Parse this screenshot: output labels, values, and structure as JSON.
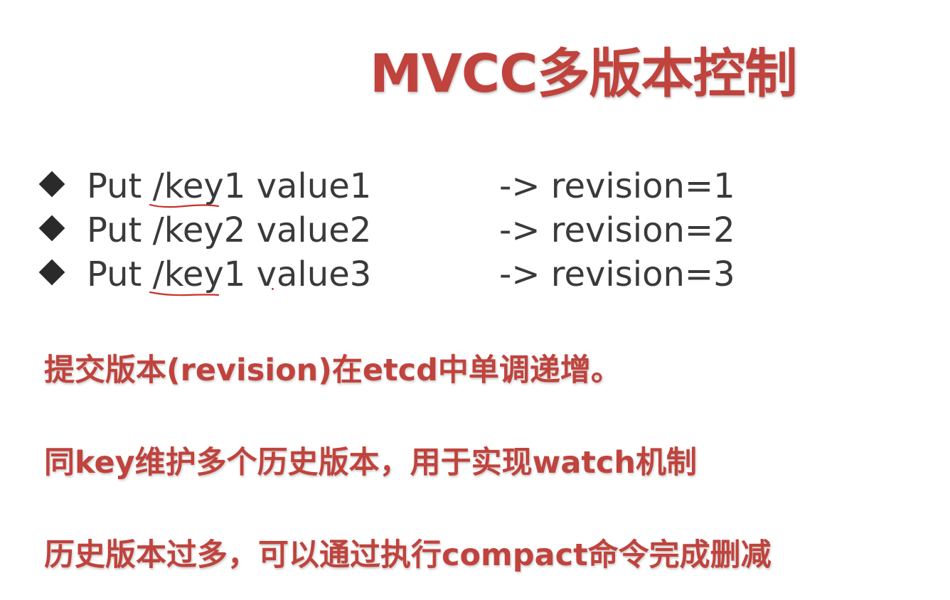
{
  "title": "MVCC多版本控制",
  "commands": [
    {
      "verb": "Put",
      "key": "/key1",
      "value": "value1",
      "revision": "-> revision=1",
      "annotated": true
    },
    {
      "verb": "Put",
      "key": "/key2",
      "value": "value2",
      "revision": "-> revision=2",
      "annotated": false
    },
    {
      "verb": "Put",
      "key": "/key1",
      "value": "value3",
      "revision": "-> revision=3",
      "annotated": true
    }
  ],
  "notes": [
    "提交版本(revision)在etcd中单调递增。",
    "同key维护多个历史版本，用于实现watch机制",
    "历史版本过多，可以通过执行compact命令完成删减"
  ],
  "colors": {
    "accent": "#c0433d",
    "body_text": "#3a3a3a",
    "bullet": "#2a2a2a",
    "annotation": "#c8322a"
  }
}
